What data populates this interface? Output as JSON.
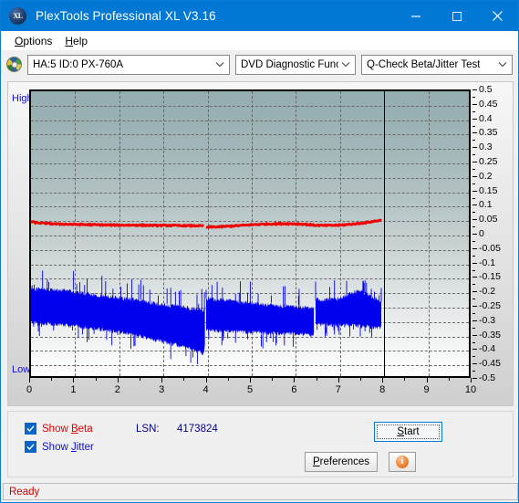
{
  "window": {
    "title": "PlexTools Professional XL V3.16",
    "app_icon": "xl-logo-icon",
    "minimize_label": "—",
    "maximize_label": "□",
    "close_label": "✕"
  },
  "menu": {
    "items": [
      {
        "label": "Options",
        "accel": "O"
      },
      {
        "label": "Help",
        "accel": "H"
      }
    ]
  },
  "toolbar": {
    "drive_icon": "optical-disc-icon",
    "drive_combo": {
      "value": "HA:5 ID:0  PX-760A"
    },
    "function_combo": {
      "value": "DVD Diagnostic Functions"
    },
    "test_combo": {
      "value": "Q-Check Beta/Jitter Test"
    }
  },
  "chart_panel": {
    "high_label": "High",
    "low_label": "Low"
  },
  "controls": {
    "show_beta": {
      "label_pre": "Show ",
      "label_accel": "B",
      "label_post": "eta",
      "checked": true
    },
    "show_jitter": {
      "label_pre": "Show ",
      "label_accel": "J",
      "label_post": "itter",
      "checked": true
    },
    "lsn_label": "LSN:",
    "lsn_value": "4173824",
    "start_button": {
      "label_pre": "",
      "label_accel": "S",
      "label_post": "tart"
    },
    "preferences_button": {
      "label_pre": "",
      "label_accel": "P",
      "label_post": "references"
    },
    "info_button": {
      "glyph": "i",
      "name": "info-icon"
    }
  },
  "statusbar": {
    "text": "Ready"
  },
  "colors": {
    "accent": "#0078d4",
    "beta_series": "#ee0000",
    "jitter_series": "#0000ee",
    "axis": "#000000",
    "grid": "#6a6a6a",
    "label_blue": "#1010d0",
    "status_red": "#d00000"
  },
  "chart_data": {
    "type": "line",
    "title": "Q-Check Beta/Jitter Test",
    "xlabel": "",
    "ylabel": "",
    "xlim": [
      0,
      10
    ],
    "ylim": [
      -0.5,
      0.5
    ],
    "grid": true,
    "legend_position": "bottom-left",
    "x_ticks": [
      0,
      1,
      2,
      3,
      4,
      5,
      6,
      7,
      8,
      9,
      10
    ],
    "y_ticks": [
      0.5,
      0.45,
      0.4,
      0.35,
      0.3,
      0.25,
      0.2,
      0.15,
      0.1,
      0.05,
      0,
      -0.05,
      -0.1,
      -0.15,
      -0.2,
      -0.25,
      -0.3,
      -0.35,
      -0.4,
      -0.45,
      -0.5
    ],
    "data_end_x": 8,
    "left_axis_annotations": [
      "High",
      "Low"
    ],
    "series": [
      {
        "name": "Beta",
        "color": "#ee0000",
        "x": [
          0.0,
          0.15,
          0.35,
          0.6,
          0.9,
          1.2,
          1.6,
          2.0,
          2.4,
          2.8,
          3.2,
          3.55,
          3.8,
          3.95,
          4.0,
          4.05,
          4.25,
          4.5,
          4.8,
          5.1,
          5.4,
          5.7,
          6.0,
          6.25,
          6.4,
          6.55,
          6.8,
          7.05,
          7.3,
          7.5,
          7.7,
          7.85,
          7.98
        ],
        "y": [
          0.042,
          0.038,
          0.036,
          0.034,
          0.033,
          0.032,
          0.031,
          0.03,
          0.03,
          0.029,
          0.029,
          0.028,
          0.028,
          0.027,
          0.022,
          0.023,
          0.024,
          0.026,
          0.029,
          0.032,
          0.034,
          0.035,
          0.035,
          0.033,
          0.031,
          0.029,
          0.029,
          0.03,
          0.033,
          0.036,
          0.04,
          0.044,
          0.047
        ]
      },
      {
        "name": "Jitter",
        "color": "#0000ee",
        "band_x": [
          0.0,
          0.5,
          1.0,
          1.5,
          2.0,
          2.5,
          3.0,
          3.5,
          3.95,
          4.0,
          4.5,
          5.0,
          5.5,
          6.0,
          6.45,
          6.5,
          7.0,
          7.5,
          7.98
        ],
        "band_top": [
          -0.195,
          -0.195,
          -0.205,
          -0.215,
          -0.225,
          -0.235,
          -0.248,
          -0.258,
          -0.268,
          -0.228,
          -0.235,
          -0.243,
          -0.25,
          -0.256,
          -0.262,
          -0.232,
          -0.228,
          -0.2,
          -0.238
        ],
        "band_bottom": [
          -0.312,
          -0.318,
          -0.325,
          -0.335,
          -0.345,
          -0.36,
          -0.378,
          -0.398,
          -0.422,
          -0.338,
          -0.342,
          -0.346,
          -0.35,
          -0.352,
          -0.356,
          -0.32,
          -0.322,
          -0.325,
          -0.33
        ]
      }
    ]
  }
}
